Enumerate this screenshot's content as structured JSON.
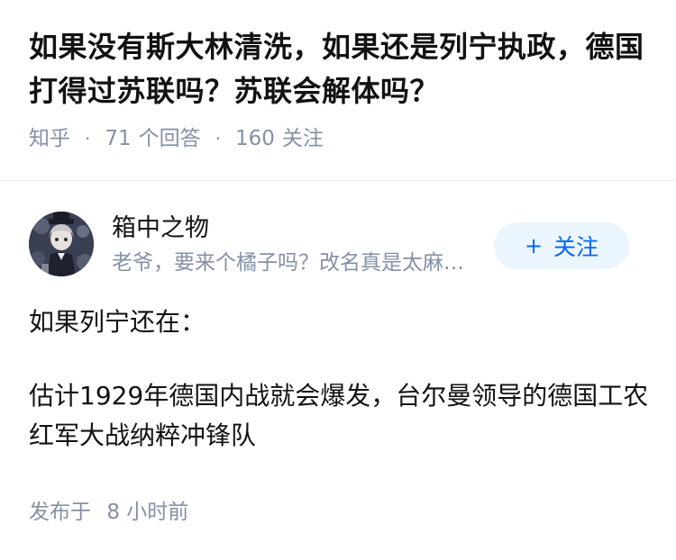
{
  "question": {
    "title": "如果没有斯大林清洗，如果还是列宁执政，德国打得过苏联吗？苏联会解体吗？",
    "source": "知乎",
    "answer_count": "71",
    "answer_label": "个回答",
    "follower_count": "160",
    "follower_label": "关注"
  },
  "author": {
    "name": "箱中之物",
    "bio": "老爷，要来个橘子吗？改名真是太麻烦了",
    "follow_label": "关注",
    "follow_icon": "plus-icon"
  },
  "answer": {
    "paragraphs": [
      "如果列宁还在：",
      "估计1929年德国内战就会爆发，台尔曼领导的德国工农红军大战纳粹冲锋队"
    ]
  },
  "footer": {
    "published_label": "发布于",
    "published_time": "8 小时前"
  },
  "colors": {
    "primary_text": "#121212",
    "secondary_text": "#8590a6",
    "accent": "#0066ff",
    "follow_bg": "#ebf5fd"
  }
}
